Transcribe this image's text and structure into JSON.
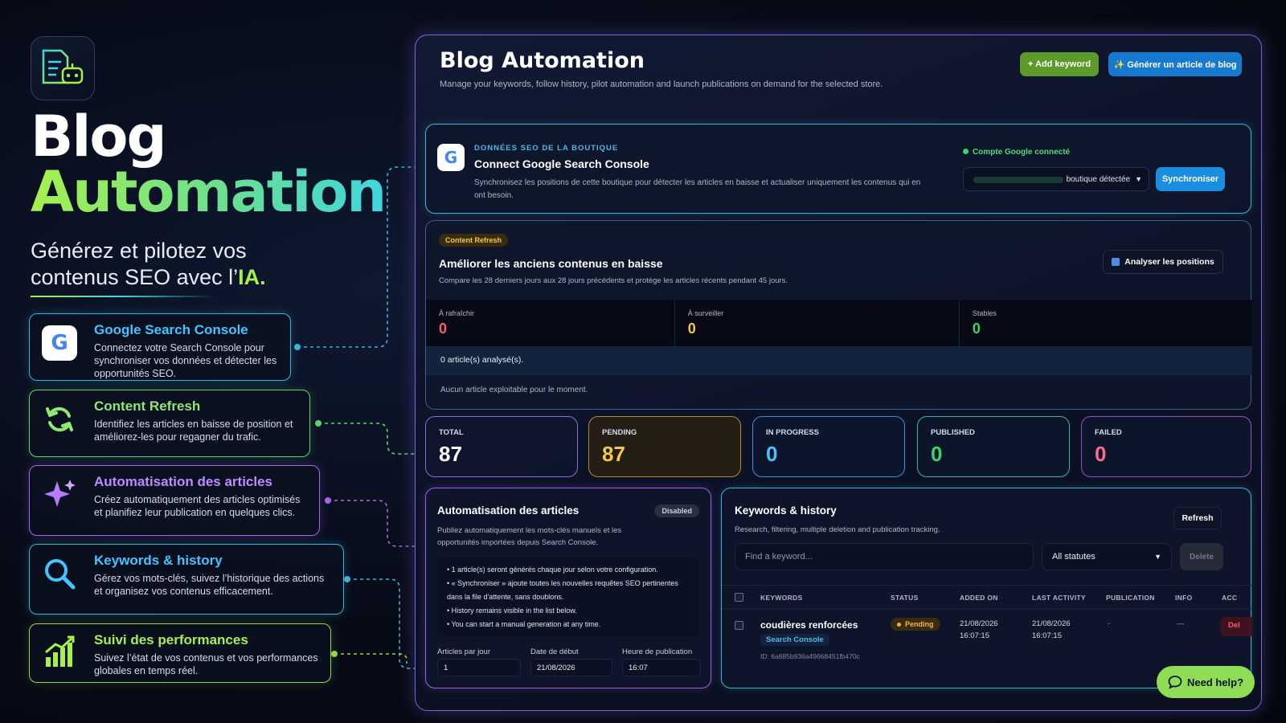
{
  "hero": {
    "title_line1": "Blog",
    "title_line2": "Automation",
    "subtitle_line1": "Générez et pilotez vos",
    "subtitle_line2": "contenus SEO avec l’",
    "subtitle_accent": "IA",
    "subtitle_end": "."
  },
  "features": [
    {
      "title": "Google Search Console",
      "desc": "Connectez votre Search Console pour synchroniser vos données et détecter les opportunités SEO.",
      "icon": "google-icon",
      "color": "#46c3ff"
    },
    {
      "title": "Content Refresh",
      "desc": "Identifiez les articles en baisse de position et améliorez-les pour regagner du trafic.",
      "icon": "refresh-icon",
      "color": "#8fe874"
    },
    {
      "title": "Automatisation des articles",
      "desc": "Créez automatiquement des articles optimisés et planifiez leur publication en quelques clics.",
      "icon": "sparkle-icon",
      "color": "#c18bff"
    },
    {
      "title": "Keywords & history",
      "desc": "Gérez vos mots-clés, suivez l’historique des actions et organisez vos contenus efficacement.",
      "icon": "search-icon",
      "color": "#46c3ff"
    },
    {
      "title": "Suivi des performances",
      "desc": "Suivez l’état de vos contenus et vos performances globales en temps réel.",
      "icon": "chart-icon",
      "color": "#a6f04e"
    }
  ],
  "app": {
    "title": "Blog Automation",
    "subtitle": "Manage your keywords, follow history, pilot automation and launch publications on demand for the selected store.",
    "add_keyword_label": "+ Add keyword",
    "generate_label": "✨ Générer un article de blog"
  },
  "gsc": {
    "eyebrow": "DONNÉES SEO DE LA BOUTIQUE",
    "title": "Connect Google Search Console",
    "desc": "Synchronisez les positions de cette boutique pour détecter les articles en baisse et actualiser uniquement les contenus qui en ont besoin.",
    "connected": "Compte Google connecté",
    "select_value": "boutique détectée",
    "sync_label": "Synchroniser"
  },
  "refresh": {
    "badge": "Content Refresh",
    "title": "Améliorer les anciens contenus en baisse",
    "desc": "Compare les 28 derniers jours aux 28 jours précédents et protège les articles récents pendant 45 jours.",
    "analyse_label": "Analyser les positions",
    "stats": [
      {
        "label": "À rafraîchir",
        "value": "0",
        "color": "#ff5a73"
      },
      {
        "label": "À surveiller",
        "value": "0",
        "color": "#f5c84a"
      },
      {
        "label": "Stables",
        "value": "0",
        "color": "#38d66a"
      }
    ],
    "analysed": "0 article(s) analysé(s).",
    "empty": "Aucun article exploitable pour le moment."
  },
  "kpis": [
    {
      "label": "TOTAL",
      "value": "87",
      "color": "#ffffff",
      "border": "#8b6be0"
    },
    {
      "label": "PENDING",
      "value": "87",
      "color": "#f5c84a",
      "border": "#b08a3a"
    },
    {
      "label": "IN PROGRESS",
      "value": "0",
      "color": "#46c3ff",
      "border": "#3a8fd6"
    },
    {
      "label": "PUBLISHED",
      "value": "0",
      "color": "#38d66a",
      "border": "#3ab6a2"
    },
    {
      "label": "FAILED",
      "value": "0",
      "color": "#ff6b8a",
      "border": "#9a4fc8"
    }
  ],
  "automation": {
    "title": "Automatisation des articles",
    "status": "Disabled",
    "desc": "Publiez automatiquement les mots-clés manuels et les opportunités importées depuis Search Console.",
    "bullets": [
      "1 article(s) seront générés chaque jour selon votre configuration.",
      "« Synchroniser » ajoute toutes les nouvelles requêtes SEO pertinentes dans la file d'attente, sans doublons.",
      "History remains visible in the list below.",
      "You can start a manual generation at any time."
    ],
    "fields": [
      {
        "label": "Articles par jour",
        "value": "1"
      },
      {
        "label": "Date de début",
        "value": "21/08/2026"
      },
      {
        "label": "Heure de publication",
        "value": "16:07"
      }
    ]
  },
  "keywords": {
    "title": "Keywords & history",
    "desc": "Research, filtering, multiple deletion and publication tracking.",
    "refresh_label": "Refresh",
    "search_placeholder": "Find a keyword...",
    "status_filter": "All statutes",
    "delete_label": "Delete",
    "columns": [
      "KEYWORDS",
      "STATUS",
      "ADDED ON",
      "LAST ACTIVITY",
      "PUBLICATION",
      "INFO",
      "ACC"
    ],
    "row": {
      "keyword": "coudières renforcées",
      "source": "Search Console",
      "id": "ID: 6a885b936a49668451fb470c",
      "status": "Pending",
      "added_date": "21/08/2026",
      "added_time": "16:07:15",
      "activity_date": "21/08/2026",
      "activity_time": "16:07:15",
      "publication": "-",
      "info": "—",
      "action": "Del"
    }
  },
  "help_label": "Need help?"
}
